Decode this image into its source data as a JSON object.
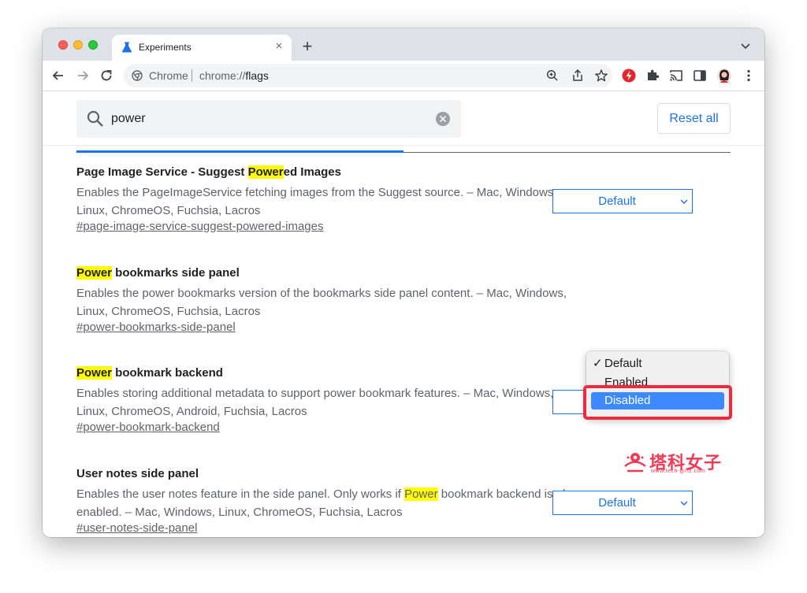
{
  "tab": {
    "title": "Experiments"
  },
  "omnibox": {
    "site_label": "Chrome",
    "url_prefix": "chrome://",
    "url_path": "flags"
  },
  "search": {
    "value": "power"
  },
  "reset_label": "Reset all",
  "experiments": [
    {
      "title_pre": "Page Image Service - Suggest ",
      "title_hl": "Power",
      "title_post": "ed Images",
      "description": "Enables the PageImageService fetching images from the Suggest source. – Mac, Windows, Linux, ChromeOS, Fuchsia, Lacros",
      "link": "#page-image-service-suggest-powered-images",
      "select_value": "Default"
    },
    {
      "title_pre": "",
      "title_hl": "Power",
      "title_post": " bookmarks side panel",
      "description": "Enables the power bookmarks version of the bookmarks side panel content. – Mac, Windows, Linux, ChromeOS, Fuchsia, Lacros",
      "link": "#power-bookmarks-side-panel"
    },
    {
      "title_pre": "",
      "title_hl": "Power",
      "title_post": " bookmark backend",
      "description": "Enables storing additional metadata to support power bookmark features. – Mac, Windows, Linux, ChromeOS, Android, Fuchsia, Lacros",
      "link": "#power-bookmark-backend",
      "select_value": "Default"
    },
    {
      "title_pre": "User notes side panel",
      "title_hl": "",
      "title_post": "",
      "desc_pre": "Enables the user notes feature in the side panel. Only works if ",
      "desc_hl": "Power",
      "desc_post": " bookmark backend is also enabled. – Mac, Windows, Linux, ChromeOS, Fuchsia, Lacros",
      "link": "#user-notes-side-panel",
      "select_value": "Default"
    }
  ],
  "dropdown": {
    "options": [
      {
        "label": "Default",
        "checked": true
      },
      {
        "label": "Enabled",
        "checked": false
      },
      {
        "label": "Disabled",
        "checked": false
      }
    ],
    "check_mark": "✓",
    "highlighted_option": "Disabled"
  },
  "watermark": {
    "text": "塔科女子",
    "sub": "www.tech-girlz.com"
  },
  "colors": {
    "accent": "#1a73e8",
    "highlight": "#ffff00",
    "annotation_red": "#ee2a3f",
    "menu_selection": "#3d8aff"
  },
  "icons": {
    "tab": "flask-icon",
    "tab_close": "close-icon",
    "new_tab": "plus-icon",
    "tab_menu": "chevron-down-icon",
    "back": "arrow-left-icon",
    "forward": "arrow-right-icon",
    "reload": "reload-icon",
    "site": "chrome-logo-icon",
    "zoom": "zoom-icon",
    "share": "share-icon",
    "bookmark": "star-icon",
    "extension_custom": "red-extension-icon",
    "extensions": "puzzle-icon",
    "cast": "cast-icon",
    "side_panel": "side-panel-icon",
    "profile": "avatar-icon",
    "menu": "kebab-menu-icon",
    "search": "search-icon",
    "clear": "clear-icon"
  }
}
